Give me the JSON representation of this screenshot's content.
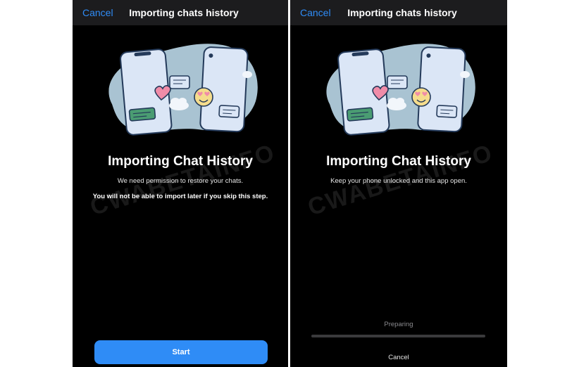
{
  "left_screen": {
    "nav_cancel": "Cancel",
    "nav_title": "Importing chats history",
    "heading": "Importing Chat History",
    "subtext": "We need permission to restore your chats.",
    "subtext_bold": "You will not be able to import later if you skip this step.",
    "start_button": "Start",
    "watermark": "CWABETAINFO"
  },
  "right_screen": {
    "nav_cancel": "Cancel",
    "nav_title": "Importing chats history",
    "heading": "Importing Chat History",
    "subtext": "Keep your phone unlocked and this app open.",
    "preparing": "Preparing",
    "progress": 0,
    "bottom_cancel": "Cancel",
    "watermark": "CWABETAINFO"
  },
  "colors": {
    "accent": "#2f8cf6",
    "background": "#000000",
    "navbar": "#1c1c1e",
    "blob": "#a9c3d2",
    "phone": "#dbe6f6",
    "phone_outline": "#243a5a",
    "heart": "#f08ca8",
    "emoji": "#f5dc8c",
    "green_bubble": "#4a9c72"
  },
  "icons": {
    "illustration": "phones-chat-transfer-illustration"
  }
}
